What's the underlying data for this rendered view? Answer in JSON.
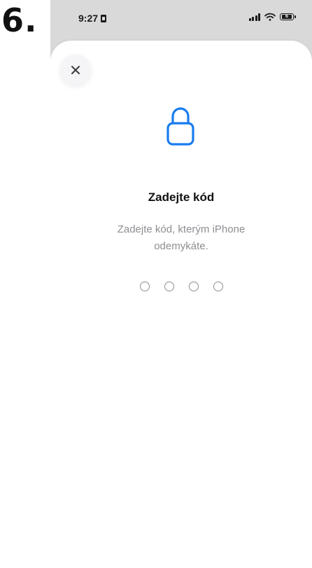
{
  "step": {
    "number": "6."
  },
  "status_bar": {
    "time": "9:27",
    "battery_level": "6"
  },
  "sheet": {
    "close_label": "×",
    "title": "Zadejte kód",
    "subtitle": "Zadejte kód, kterým iPhone odemykáte.",
    "passcode_length": 4
  },
  "icons": {
    "close": "close-icon",
    "lock": "lock-icon",
    "signal": "signal-icon",
    "wifi": "wifi-icon",
    "battery": "battery-icon",
    "sim": "sim-icon"
  },
  "colors": {
    "accent": "#1a7cf0",
    "sheet_background": "#ffffff",
    "backdrop": "#d9d9d9",
    "secondary_text": "#8e8e93"
  }
}
